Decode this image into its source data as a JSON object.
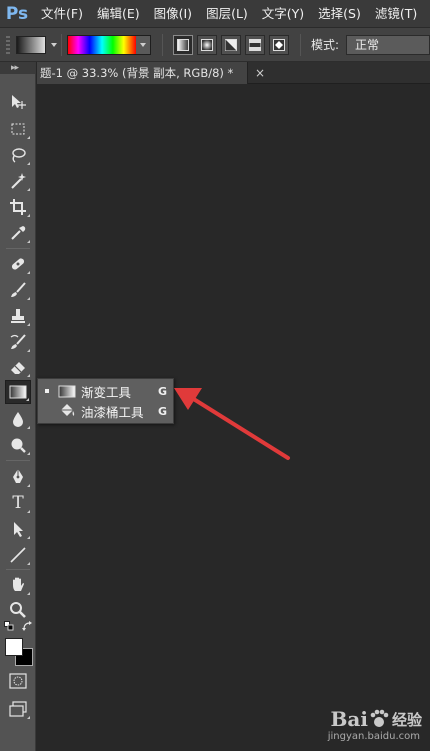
{
  "app": {
    "logo": "Ps"
  },
  "menu": [
    "文件(F)",
    "编辑(E)",
    "图像(I)",
    "图层(L)",
    "文字(Y)",
    "选择(S)",
    "滤镜(T)"
  ],
  "options": {
    "mode_label": "模式:",
    "mode_value": "正常",
    "gradient_types": [
      "linear-gradient-icon",
      "radial-gradient-icon",
      "angle-gradient-icon",
      "reflected-gradient-icon",
      "diamond-gradient-icon"
    ]
  },
  "toolbar": {
    "collapse_glyph": "▸▸",
    "tools": [
      "move-tool-icon",
      "marquee-tool-icon",
      "lasso-tool-icon",
      "magic-wand-icon",
      "crop-tool-icon",
      "eyedropper-icon",
      "healing-brush-icon",
      "brush-tool-icon",
      "clone-stamp-icon",
      "history-brush-icon",
      "eraser-icon",
      "gradient-tool-icon",
      "blur-tool-icon",
      "dodge-tool-icon",
      "pen-tool-icon",
      "type-tool-icon",
      "path-selection-icon",
      "line-tool-icon",
      "hand-tool-icon",
      "zoom-tool-icon"
    ],
    "type_glyph": "T"
  },
  "document": {
    "tab_title": "题-1 @ 33.3% (背景 副本, RGB/8) *",
    "close_glyph": "×"
  },
  "flyout": {
    "items": [
      {
        "label": "渐变工具",
        "key": "G"
      },
      {
        "label": "油漆桶工具",
        "key": "G"
      }
    ]
  },
  "watermark": {
    "brand": "Bai",
    "brand2": "经验",
    "url": "jingyan.baidu.com"
  },
  "colors": {
    "annotation_arrow": "#e03a3a",
    "foreground": "#ffffff",
    "background": "#000000"
  }
}
